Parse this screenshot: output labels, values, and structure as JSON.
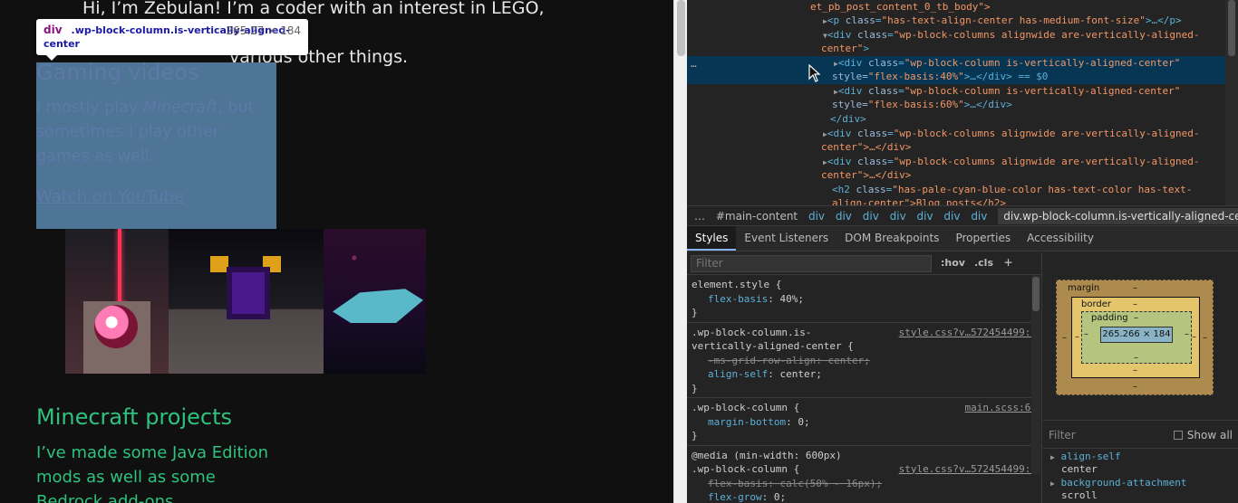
{
  "site": {
    "intro_line1": "Hi, I’m Zebulan! I’m a coder with an interest in LEGO, Minecraft,",
    "intro_line2": "various other things.",
    "gaming": {
      "title": "Gaming videos",
      "text_before": "I mostly play ",
      "text_italic": "Minecraft",
      "text_after": ", but sometimes I play other games as well.",
      "link": "Watch on YouTube"
    },
    "minecraft": {
      "title": "Minecraft projects",
      "text": "I’ve made some Java Edition mods as well as some Bedrock add-ons"
    }
  },
  "tooltip": {
    "tag": "div",
    "class_text": ".wp-block-column.is-vertically-aligned-center",
    "dims": "265.27 × 184"
  },
  "dom": {
    "line0": "et_pb_post_content_0_tb_body\">",
    "p_tag": "p",
    "p_class_attr": "class",
    "p_class_val": "\"has-text-align-center has-medium-font-size\"",
    "p_rest": ">…</",
    "p_close": "p",
    "cols_class_val": "\"wp-block-columns alignwide are-vertically-aligned-",
    "cols_class_val2": "center\"",
    "col1_class_val": "\"wp-block-column is-vertically-aligned-center\"",
    "col1_style": "style=",
    "col1_style_val": "\"flex-basis:40%\"",
    "col1_rest": ">…</div> == $0",
    "col2_style_val": "\"flex-basis:60%\"",
    "col2_rest": ">…</div>",
    "close_div": "</div>",
    "cols2_class_val": "\"wp-block-columns alignwide are-vertically-aligned-",
    "cols2_rest": "center\">…</div>",
    "h2_class_val": "\"has-pale-cyan-blue-color has-text-color has-text-",
    "h2_rest": "align-center\">Blog posts</h2>",
    "dots": "…"
  },
  "breadcrumbs": {
    "first": "…",
    "main": "#main-content",
    "items": [
      "div",
      "div",
      "div",
      "div",
      "div",
      "div",
      "div"
    ],
    "last": "div.wp-block-column.is-vertically-aligned-center"
  },
  "tabs": [
    "Styles",
    "Event Listeners",
    "DOM Breakpoints",
    "Properties",
    "Accessibility"
  ],
  "styles": {
    "filter_placeholder": "Filter",
    "hov": ":hov",
    "cls": ".cls",
    "plus": "+",
    "rule1_sel": "element.style {",
    "rule1_prop": "flex-basis",
    "rule1_val": "40%;",
    "rule2_sel": ".wp-block-column.is-",
    "rule2_sel2": "vertically-aligned-center {",
    "rule2_src": "style.css?v…572454499:1",
    "rule2_p1": "-ms-grid-row-align",
    "rule2_v1": "center;",
    "rule2_p2": "align-self",
    "rule2_v2": "center;",
    "rule3_sel": ".wp-block-column {",
    "rule3_src": "main.scss:66",
    "rule3_p1": "margin-bottom",
    "rule3_v1": "0;",
    "rule4_media": "@media (min-width: 600px)",
    "rule4_sel": ".wp-block-column {",
    "rule4_src": "style.css?v…572454499:1",
    "rule4_p1": "flex-basis",
    "rule4_v1": "calc(50% - 16px);",
    "rule4_p2": "flex-grow",
    "rule4_v2": "0;",
    "close": "}"
  },
  "boxmodel": {
    "margin": "margin",
    "border": "border",
    "padding": "padding",
    "content": "265.266 × 184",
    "dash": "–"
  },
  "computed": {
    "filter_placeholder": "Filter",
    "show_all": "Show all",
    "p1_name": "align-self",
    "p1_val": "center",
    "p2_name": "background-attachment",
    "p2_val": "scroll"
  }
}
